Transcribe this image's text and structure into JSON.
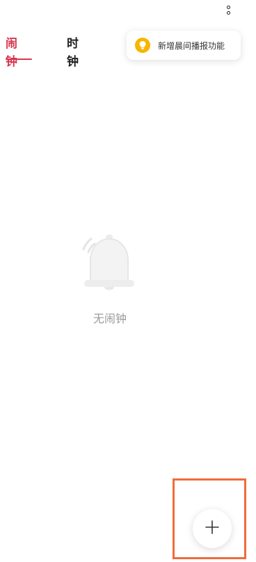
{
  "header": {
    "more_icon": "more-vertical-icon"
  },
  "tabs": [
    {
      "label": "闹钟",
      "active": true
    },
    {
      "label": "时钟",
      "active": false
    }
  ],
  "tooltip": {
    "icon": "lightbulb-icon",
    "text": "新增晨间播报功能"
  },
  "empty_state": {
    "icon": "bell-icon",
    "text": "无闹钟"
  },
  "fab": {
    "icon": "plus-icon"
  },
  "colors": {
    "accent": "#d8364f",
    "tooltip_icon": "#f7b500",
    "highlight": "#f06b3b",
    "muted_text": "#9a9a9a"
  }
}
